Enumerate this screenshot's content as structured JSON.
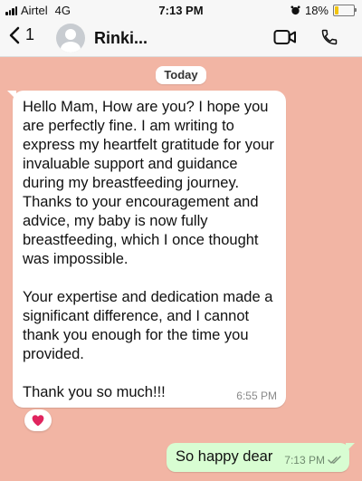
{
  "status_bar": {
    "carrier": "Airtel",
    "network": "4G",
    "time": "7:13 PM",
    "battery": "18%",
    "battery_level": 0.18
  },
  "header": {
    "back_count": "1",
    "contact_name": "Rinki..."
  },
  "chat": {
    "date_label": "Today",
    "incoming": {
      "text": "Hello Mam, How are you? I hope you are perfectly fine. I am writing to express my heartfelt gratitude for your invaluable support and guidance during my breastfeeding journey. Thanks to your encouragement and advice, my baby is now fully breastfeeding, which I once thought was impossible.\n\nYour expertise and dedication made a significant difference, and I cannot thank you enough for the time you provided.\n\nThank you so much!!!",
      "time": "6:55 PM",
      "reaction": "❤️"
    },
    "outgoing": {
      "text": "So happy dear",
      "time": "7:13 PM",
      "status_icon": "double-check-icon"
    }
  },
  "colors": {
    "wallpaper": "#f2b5a4",
    "incoming_bubble": "#ffffff",
    "outgoing_bubble": "#d8fdd2"
  }
}
